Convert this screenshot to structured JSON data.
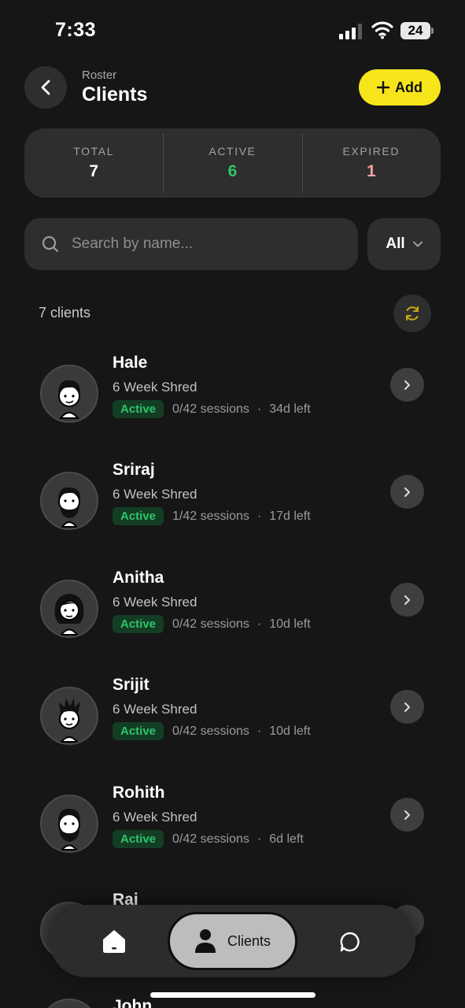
{
  "status_bar": {
    "time": "7:33",
    "battery": "24"
  },
  "header": {
    "subtitle": "Roster",
    "title": "Clients",
    "add_label": "Add"
  },
  "stats": [
    {
      "label": "TOTAL",
      "value": "7",
      "color": "#ffffff"
    },
    {
      "label": "ACTIVE",
      "value": "6",
      "color": "#2ec46b"
    },
    {
      "label": "EXPIRED",
      "value": "1",
      "color": "#f4a4a4"
    }
  ],
  "search": {
    "placeholder": "Search by name...",
    "value": ""
  },
  "filter": {
    "selected": "All"
  },
  "list": {
    "count_text": "7 clients"
  },
  "clients": [
    {
      "name": "Hale",
      "plan": "6 Week Shred",
      "status": "Active",
      "sessions": "0/42 sessions",
      "left": "34d left"
    },
    {
      "name": "Sriraj",
      "plan": "6 Week Shred",
      "status": "Active",
      "sessions": "1/42 sessions",
      "left": "17d left"
    },
    {
      "name": "Anitha",
      "plan": "6 Week Shred",
      "status": "Active",
      "sessions": "0/42 sessions",
      "left": "10d left"
    },
    {
      "name": "Srijit",
      "plan": "6 Week Shred",
      "status": "Active",
      "sessions": "0/42 sessions",
      "left": "10d left"
    },
    {
      "name": "Rohith",
      "plan": "6 Week Shred",
      "status": "Active",
      "sessions": "0/42 sessions",
      "left": "6d left"
    },
    {
      "name": "Rai"
    },
    {
      "name": "John"
    }
  ],
  "nav": {
    "home_icon": "home-icon",
    "clients_label": "Clients",
    "chat_icon": "chat-icon"
  },
  "colors": {
    "accent": "#f6e51a",
    "active": "#2ec46b",
    "expired": "#f4a4a4",
    "background": "#161616",
    "card": "#2e2e2e"
  }
}
